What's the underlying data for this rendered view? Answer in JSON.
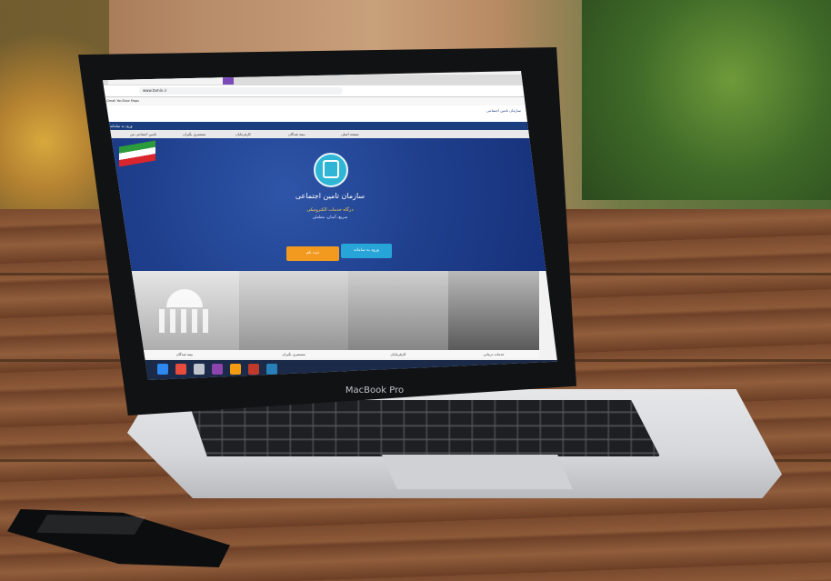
{
  "device": {
    "lid_label": "MacBook Pro"
  },
  "browser": {
    "tabs": [
      "",
      "",
      ""
    ],
    "url": "www.tamin.ir",
    "bookmarks": "M Gmail   YouTube   Maps"
  },
  "site": {
    "header_logo": "سازمان تامین اجتماعی",
    "ribbon": "ورود به سامانه",
    "nav": [
      "صفحه اصلی",
      "بیمه شدگان",
      "کارفرمایان",
      "مستمری بگیران",
      "تامین اجتماعی من"
    ],
    "hero_title": "سازمان تامین اجتماعی",
    "hero_sub1": "درگاه خدمات الکترونیکی",
    "hero_sub2": "سریع، آسان، مطمئن",
    "login_button": "ورود به سامانه",
    "register_button": "ثبت نام",
    "tiles": [
      "بیمه شدگان",
      "مستمری بگیران",
      "کارفرمایان",
      "خدمات درمانی"
    ]
  },
  "colors": {
    "hero": "#1f3f8c",
    "login": "#27a4d8",
    "register": "#f29a1f",
    "emblem": "#2fb6d6"
  },
  "icons": [
    "emblem-logo-icon",
    "flag-icon",
    "umbrella-family-icon"
  ]
}
